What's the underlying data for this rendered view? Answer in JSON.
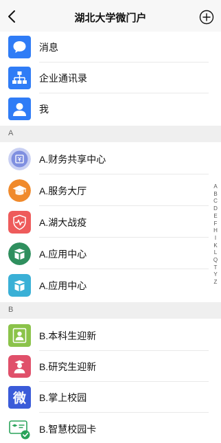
{
  "header": {
    "title": "湖北大学微门户"
  },
  "top_items": [
    {
      "label": "消息",
      "icon": "message-icon",
      "color": "#2f7cf6"
    },
    {
      "label": "企业通讯录",
      "icon": "org-chart-icon",
      "color": "#2f7cf6"
    },
    {
      "label": "我",
      "icon": "user-icon",
      "color": "#2f7cf6"
    }
  ],
  "sections": [
    {
      "letter": "A",
      "items": [
        {
          "label": "A.财务共享中心",
          "icon": "finance-icon",
          "color": "#7f8fe0"
        },
        {
          "label": "A.服务大厅",
          "icon": "graduation-cap-icon",
          "color": "#f08a2c"
        },
        {
          "label": "A.湖大战疫",
          "icon": "shield-heartbeat-icon",
          "color": "#ee5b5b"
        },
        {
          "label": "A.应用中心",
          "icon": "box-icon",
          "color": "#2f8f5e"
        },
        {
          "label": "A.应用中心",
          "icon": "box-icon",
          "color": "#3ab0d6"
        }
      ]
    },
    {
      "letter": "B",
      "items": [
        {
          "label": "B.本科生迎新",
          "icon": "freshman-icon",
          "color": "#8bc34a"
        },
        {
          "label": "B.研究生迎新",
          "icon": "graduate-icon",
          "color": "#e0506a"
        },
        {
          "label": "B.掌上校园",
          "icon": "wei-icon",
          "color": "#3a5bd9"
        },
        {
          "label": "B.智慧校园卡",
          "icon": "campus-card-icon",
          "color": "#2aa35a"
        }
      ]
    }
  ],
  "index_letters": [
    "A",
    "B",
    "C",
    "D",
    "E",
    "F",
    "H",
    "I",
    "K",
    "L",
    "Q",
    "T",
    "Y",
    "Z"
  ]
}
